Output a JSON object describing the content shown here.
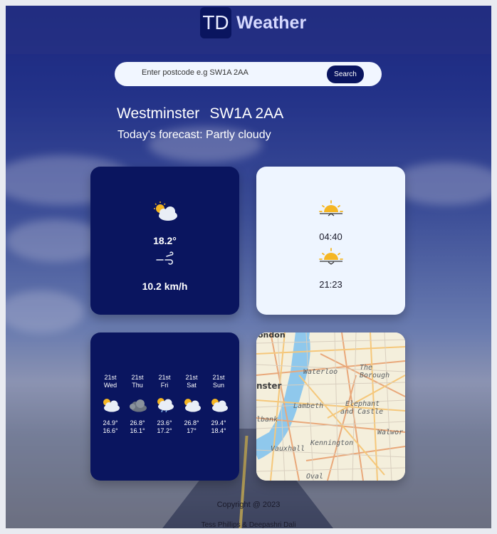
{
  "header": {
    "logo": "TD",
    "title": "Weather"
  },
  "search": {
    "placeholder": "Enter postcode e.g SW1A 2AA",
    "button_label": "Search"
  },
  "location": {
    "area": "Westminster",
    "postcode": "SW1A 2AA"
  },
  "forecast_text": "Today's forecast: Partly cloudy",
  "today": {
    "icon": "partly-cloudy-icon",
    "temperature": "18.2°",
    "wind_icon": "wind-icon",
    "wind": "10.2 km/h"
  },
  "sun": {
    "sunrise_icon": "sunrise-icon",
    "sunrise": "04:40",
    "sunset_icon": "sunset-icon",
    "sunset": "21:23"
  },
  "week": [
    {
      "date": "21st",
      "day": "Wed",
      "icon": "partly-cloudy-icon",
      "high": "24.9°",
      "low": "16.6°"
    },
    {
      "date": "21st",
      "day": "Thu",
      "icon": "cloudy-icon",
      "high": "26.8°",
      "low": "16.1°"
    },
    {
      "date": "21st",
      "day": "Fri",
      "icon": "partly-cloudy-rain-icon",
      "high": "23.6°",
      "low": "17.2°"
    },
    {
      "date": "21st",
      "day": "Sat",
      "icon": "partly-cloudy-icon",
      "high": "26.8°",
      "low": "17°"
    },
    {
      "date": "21st",
      "day": "Sun",
      "icon": "partly-cloudy-icon",
      "high": "29.4°",
      "low": "18.4°"
    }
  ],
  "map": {
    "labels": [
      "ondon",
      "Waterloo",
      "The Borough",
      "Lambeth",
      "Elephant",
      "and Castle",
      "nster",
      "lbank",
      "Vauxhall",
      "Kennington",
      "Walwor",
      "Oval"
    ]
  },
  "footer": {
    "copyright": "Copyright @ 2023",
    "authors": "Tess Phillips & Deepashri Dali"
  },
  "colors": {
    "accent": "#0a155f",
    "card_light": "#eef5ff",
    "sun": "#f5b623"
  }
}
